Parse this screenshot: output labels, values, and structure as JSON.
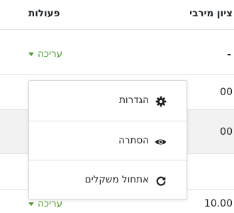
{
  "table": {
    "header": {
      "max_grade": "ציון מירבי",
      "actions": "פעולות"
    },
    "rows": [
      {
        "value": "-",
        "action": "עריכה"
      },
      {
        "value": "00"
      },
      {
        "value": "00"
      },
      {
        "value": ""
      },
      {
        "value": "10.00",
        "action": "עריכה"
      }
    ]
  },
  "action_menu": {
    "items": [
      {
        "label": "הגדרות",
        "icon": "gear-icon"
      },
      {
        "label": "הסתרה",
        "icon": "eye-icon"
      },
      {
        "label": "אתחול משקלים",
        "icon": "refresh-icon"
      }
    ]
  },
  "colors": {
    "link": "#4f9a2e",
    "shaded_row": "#f2f2f2",
    "text": "#1d2125"
  }
}
